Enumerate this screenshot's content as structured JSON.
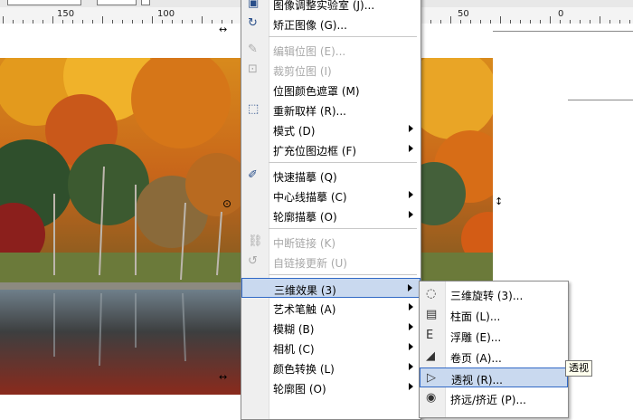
{
  "ruler": {
    "labels": [
      "150",
      "100",
      "50",
      "0"
    ]
  },
  "colors": {
    "menu_highlight": "#c9d9ef",
    "highlight_border": "#3169c6",
    "disabled_text": "#a8a8a8"
  },
  "main_menu": {
    "items": [
      {
        "label": "图像调整实验室 (J)...",
        "disabled": false,
        "submenu": false,
        "icon": "image-lab-icon"
      },
      {
        "label": "矫正图像 (G)...",
        "disabled": false,
        "submenu": false,
        "icon": "straighten-image-icon"
      },
      {
        "label": "编辑位图 (E)...",
        "disabled": true,
        "submenu": false,
        "icon": "edit-bitmap-icon"
      },
      {
        "label": "裁剪位图 (I)",
        "disabled": true,
        "submenu": false,
        "icon": "crop-bitmap-icon"
      },
      {
        "label": "位图颜色遮罩 (M)",
        "disabled": false,
        "submenu": false,
        "icon": ""
      },
      {
        "label": "重新取样 (R)...",
        "disabled": false,
        "submenu": false,
        "icon": "resample-icon"
      },
      {
        "label": "模式 (D)",
        "disabled": false,
        "submenu": true,
        "icon": ""
      },
      {
        "label": "扩充位图边框 (F)",
        "disabled": false,
        "submenu": true,
        "icon": ""
      },
      {
        "label": "快速描摹 (Q)",
        "disabled": false,
        "submenu": false,
        "icon": "quick-trace-icon"
      },
      {
        "label": "中心线描摹 (C)",
        "disabled": false,
        "submenu": true,
        "icon": ""
      },
      {
        "label": "轮廓描摹 (O)",
        "disabled": false,
        "submenu": true,
        "icon": ""
      },
      {
        "label": "中断链接 (K)",
        "disabled": true,
        "submenu": false,
        "icon": "break-link-icon"
      },
      {
        "label": "自链接更新 (U)",
        "disabled": true,
        "submenu": false,
        "icon": "update-link-icon"
      },
      {
        "label": "三维效果 (3)",
        "disabled": false,
        "submenu": true,
        "icon": "",
        "highlighted": true
      },
      {
        "label": "艺术笔触 (A)",
        "disabled": false,
        "submenu": true,
        "icon": ""
      },
      {
        "label": "模糊 (B)",
        "disabled": false,
        "submenu": true,
        "icon": ""
      },
      {
        "label": "相机 (C)",
        "disabled": false,
        "submenu": true,
        "icon": ""
      },
      {
        "label": "颜色转换 (L)",
        "disabled": false,
        "submenu": true,
        "icon": ""
      },
      {
        "label": "轮廓图 (O)",
        "disabled": false,
        "submenu": true,
        "icon": ""
      }
    ]
  },
  "submenu_3d": {
    "items": [
      {
        "label": "三维旋转 (3)...",
        "icon": "3d-rotate-icon"
      },
      {
        "label": "柱面 (L)...",
        "icon": "cylinder-icon"
      },
      {
        "label": "浮雕 (E)...",
        "icon": "emboss-icon"
      },
      {
        "label": "卷页 (A)...",
        "icon": "page-curl-icon"
      },
      {
        "label": "透视 (R)...",
        "icon": "perspective-icon",
        "highlighted": true
      },
      {
        "label": "挤远/挤近 (P)...",
        "icon": "pinch-punch-icon"
      }
    ]
  },
  "tooltip": {
    "text": "透视"
  }
}
